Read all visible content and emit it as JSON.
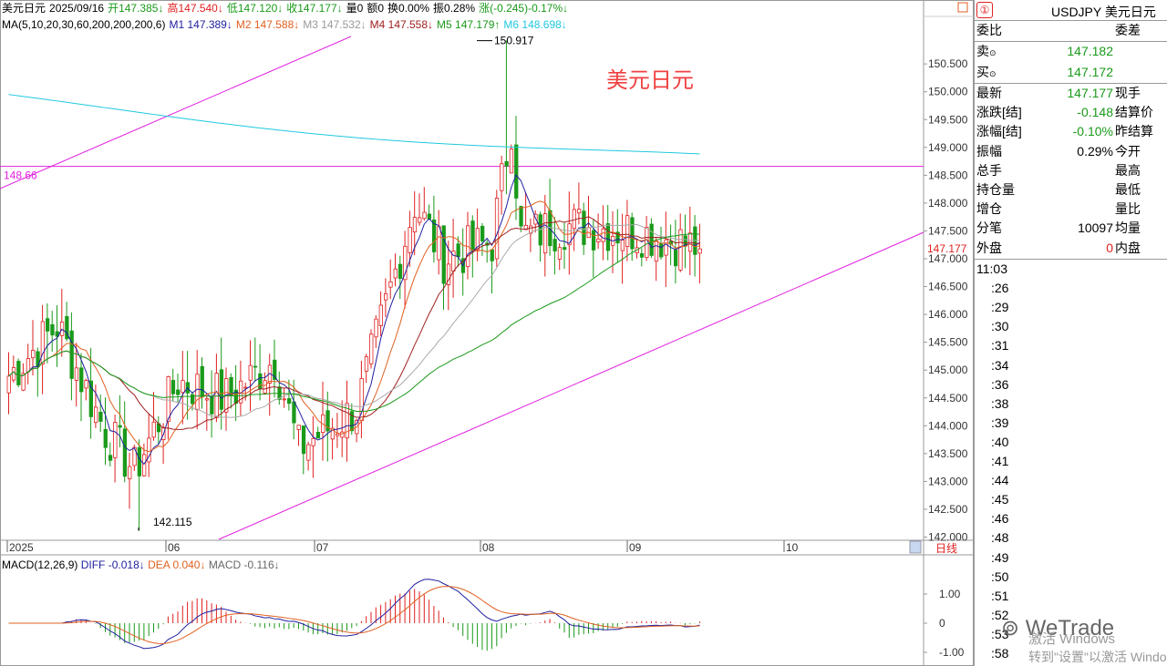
{
  "header": {
    "symbol_name": "美元日元",
    "date": "2025/09/16",
    "open": "开147.385↓",
    "high": "高147.540↓",
    "low": "低147.120↓",
    "close": "收147.177↓",
    "volume": "量0",
    "amount": "额0",
    "turnover": "换0.00%",
    "amplitude": "振0.28%",
    "change": "涨(-0.245)-0.17%↓"
  },
  "ma_line": {
    "label": "MA(5,10,20,30,60,200,200,200,6)",
    "m1": "M1 147.389↓",
    "m2": "M2 147.588↓",
    "m3": "M3 147.532↓",
    "m4": "M4 147.558↓",
    "m5": "M5 147.179↑",
    "m6": "M6 148.698↓",
    "m1_color": "#2020a0",
    "m2_color": "#e06020",
    "m3_color": "#999999",
    "m4_color": "#a02020",
    "m5_color": "#1a9a1a",
    "m6_color": "#20c8e0"
  },
  "macd_line": {
    "label": "MACD(12,26,9)",
    "diff": "DIFF -0.018↓",
    "dea": "DEA 0.040↓",
    "macd": "MACD -0.116↓"
  },
  "price_axis": {
    "labels": [
      "150.500",
      "150.000",
      "149.500",
      "149.000",
      "148.500",
      "148.000",
      "147.500",
      "147.000",
      "146.500",
      "146.000",
      "145.500",
      "145.000",
      "144.500",
      "144.000",
      "143.500",
      "143.000",
      "142.500",
      "142.000"
    ],
    "current": "147.177",
    "hline_label": "148.66"
  },
  "macd_axis": {
    "labels": [
      "1.00",
      "0",
      "-1.00"
    ]
  },
  "time_axis": {
    "labels": [
      "2025",
      "06",
      "07",
      "08",
      "09",
      "10"
    ],
    "period_button": "日线"
  },
  "annotations": {
    "high": "150.917",
    "low": "142.115",
    "overlay_title": "美元日元"
  },
  "right_panel": {
    "title": "USDJPY 美元日元",
    "badge": "①",
    "bid_ask_left": "委比",
    "bid_ask_right": "委差",
    "sell_label": "卖",
    "sell_value": "147.182",
    "buy_label": "买",
    "buy_value": "147.172",
    "rows": [
      {
        "l": "最新",
        "v": "147.177",
        "r": "现手",
        "vc": "#1a9a1a"
      },
      {
        "l": "涨跌[结]",
        "v": "-0.148",
        "r": "结算价",
        "vc": "#1a9a1a"
      },
      {
        "l": "涨幅[结]",
        "v": "-0.10%",
        "r": "昨结算",
        "vc": "#1a9a1a"
      },
      {
        "l": "振幅",
        "v": "0.29%",
        "r": "今开",
        "vc": "#000000"
      },
      {
        "l": "总手",
        "v": "",
        "r": "最高",
        "vc": "#000000"
      },
      {
        "l": "持仓量",
        "v": "",
        "r": "最低",
        "vc": "#000000"
      },
      {
        "l": "增仓",
        "v": "",
        "r": "量比",
        "vc": "#000000"
      },
      {
        "l": "分笔",
        "v": "10097",
        "r": "均量",
        "vc": "#000000"
      },
      {
        "l": "外盘",
        "v": "0",
        "r": "内盘",
        "vc": "#e02020"
      }
    ],
    "times": [
      "11:03",
      ":26",
      ":29",
      ":30",
      ":31",
      ":34",
      ":36",
      ":38",
      ":39",
      ":40",
      ":41",
      ":44",
      ":45",
      ":46",
      ":48",
      ":49",
      ":50",
      ":51",
      ":52",
      ":53",
      ":58"
    ]
  },
  "watermark": {
    "wetrade": "WeTrade",
    "activate1": "激活 Windows",
    "activate2": "转到\"设置\"以激活 Windo"
  },
  "colors": {
    "up": "#e02020",
    "down": "#1a9a1a",
    "trendline": "#e020e0",
    "ma200": "#20c8e0"
  },
  "chart_data": {
    "type": "candlestick",
    "x_labels": [
      "2025",
      "06",
      "07",
      "08",
      "09",
      "10"
    ],
    "ylim": [
      142.0,
      150.917
    ],
    "annotated_high": 150.917,
    "annotated_low": 142.115,
    "hline": 148.66
  }
}
